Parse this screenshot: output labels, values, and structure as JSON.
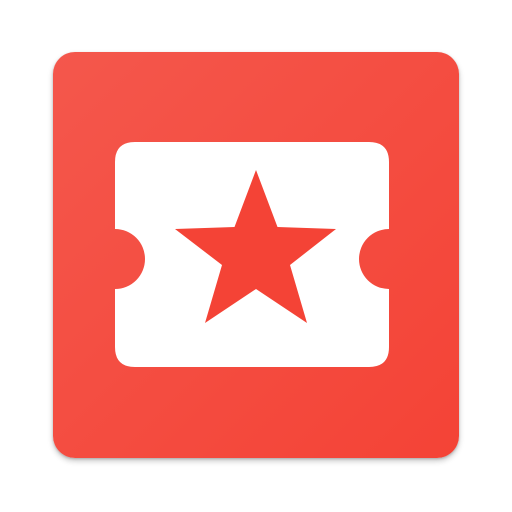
{
  "icon": {
    "name": "ticket-star-app-icon",
    "background_color": "#f44336",
    "background_highlight": "#f4574c",
    "ticket_color": "#ffffff",
    "star_color": "#f44336"
  }
}
